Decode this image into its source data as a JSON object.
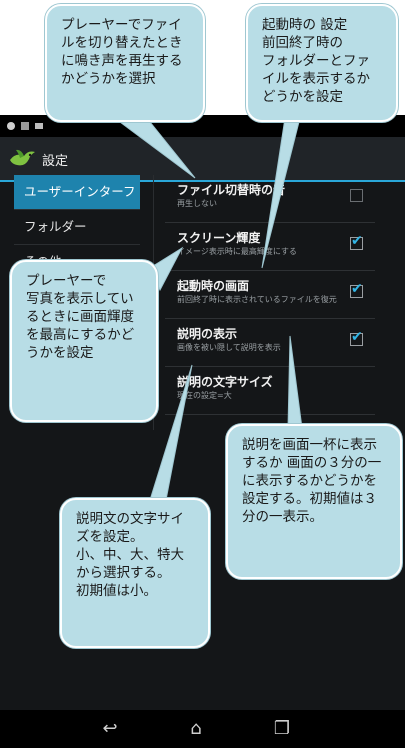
{
  "app": {
    "title": "設定"
  },
  "sidebar": {
    "items": [
      {
        "label": "ユーザーインターフ",
        "active": true
      },
      {
        "label": "フォルダー",
        "active": false
      },
      {
        "label": "その他",
        "active": false
      }
    ]
  },
  "settings": [
    {
      "title": "ファイル切替時の音",
      "subtitle": "再生しない",
      "checked": false,
      "has_checkbox": true
    },
    {
      "title": "スクリーン輝度",
      "subtitle": "イメージ表示時に最高輝度にする",
      "checked": true,
      "has_checkbox": true
    },
    {
      "title": "起動時の画面",
      "subtitle": "前回終了時に表示されているファイルを復元",
      "checked": true,
      "has_checkbox": true
    },
    {
      "title": "説明の表示",
      "subtitle": "画像を被い隠して説明を表示",
      "checked": true,
      "has_checkbox": true
    },
    {
      "title": "説明の文字サイズ",
      "subtitle": "現在の設定=大",
      "checked": false,
      "has_checkbox": false
    }
  ],
  "callouts": {
    "file_switch": "プレーヤーでファイルを切り替えたときに鳴き声を再生するかどうかを選択",
    "startup": "起動時の 設定\n前回終了時の\nフォルダーとファイルを表示するかどうかを設定",
    "brightness": "プレーヤーで\n写真を表示しているときに画面輝度を最高にするかどうかを設定",
    "desc_display": "説明を画面一杯に表示するか 画面の３分の一に表示するかどうかを設定する。初期値は３分の一表示。",
    "font_size": "説明文の文字サイズを設定。\n小、中、大、特大から選択する。\n初期値は小。"
  },
  "colors": {
    "accent": "#2aa7d8",
    "bubble": "#b8dde6",
    "check": "#33b5e5"
  },
  "icons": {
    "app": "bird-icon",
    "back": "back-icon",
    "home": "home-icon",
    "recents": "recents-icon"
  }
}
